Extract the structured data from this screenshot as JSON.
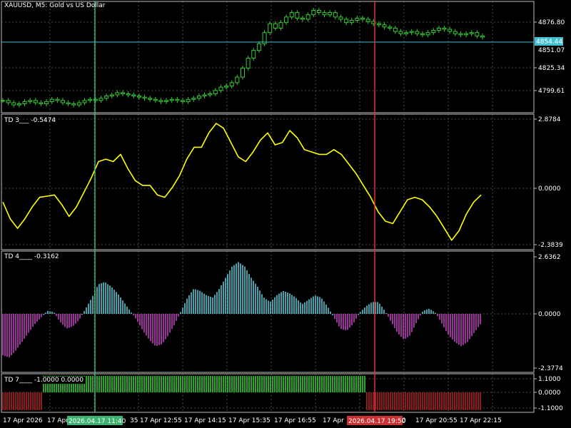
{
  "symbol_title": "XAUUSD, M5:  Gold vs US Dollar",
  "colors": {
    "background": "#000000",
    "grid": "#4a4a4a",
    "frame": "#c0c0c0",
    "candle": "#32cd32",
    "crosshair_green": "#3cb371",
    "crosshair_red": "#dc3232",
    "current_price_line": "#40c0d0",
    "td3_line": "#ffff00",
    "histogram_up": "#5bc8d8",
    "histogram_down": "#c040c0",
    "td7_up": "#32cd32",
    "td7_down": "#b22222"
  },
  "price_panel": {
    "axis_labels": [
      "4876.80",
      "4825.34",
      "4799.61"
    ],
    "current_price": "4854.44",
    "current_price_hidden_label": "4851.07"
  },
  "td3_panel": {
    "title": "TD 3___ -0.5474",
    "axis_labels": [
      "2.8784",
      "0.0000",
      "-2.3839"
    ]
  },
  "td4_panel": {
    "title": "TD 4____ -0.3162",
    "axis_labels": [
      "2.6362",
      "0.0000",
      "-2.3774"
    ]
  },
  "td7_panel": {
    "title": "TD 7____ -1.0000 0.0000",
    "axis_labels": [
      "1.1000",
      "0.0000",
      "-1.1000"
    ]
  },
  "time_axis": {
    "labels": [
      "17 Apr 2026",
      "17 Apr",
      "35",
      "17 Apr 12:55",
      "17 Apr 14:15",
      "17 Apr 15:35",
      "17 Apr 16:55",
      "17 Apr 1",
      "0",
      "17 Apr 20:55",
      "17 Apr 22:15"
    ],
    "cursor_green_label": "2026.04.17 11:40",
    "cursor_red_label": "2026.04.17 19:50"
  },
  "chart_data": {
    "type": "line",
    "title": "XAUUSD, M5:  Gold vs US Dollar",
    "price_series": {
      "name": "XAUUSD",
      "values": [
        4797,
        4795,
        4793,
        4794,
        4796,
        4797,
        4795,
        4794,
        4796,
        4798,
        4797,
        4795,
        4794,
        4793,
        4795,
        4797,
        4798,
        4797,
        4799,
        4801,
        4802,
        4804,
        4803,
        4802,
        4801,
        4800,
        4799,
        4798,
        4797,
        4796,
        4797,
        4798,
        4797,
        4796,
        4798,
        4799,
        4801,
        4802,
        4803,
        4806,
        4809,
        4810,
        4813,
        4818,
        4826,
        4835,
        4842,
        4848,
        4858,
        4866,
        4862,
        4867,
        4872,
        4876,
        4871,
        4870,
        4874,
        4878,
        4876,
        4874,
        4876,
        4872,
        4870,
        4867,
        4869,
        4871,
        4870,
        4868,
        4866,
        4865,
        4863,
        4862,
        4859,
        4857,
        4858,
        4859,
        4857,
        4856,
        4858,
        4860,
        4862,
        4861,
        4859,
        4857,
        4856,
        4857,
        4858,
        4855,
        4854
      ]
    },
    "td3_series": {
      "values": [
        -0.6,
        -1.3,
        -1.7,
        -1.3,
        -0.8,
        -0.4,
        -0.35,
        -0.3,
        -0.7,
        -1.2,
        -0.8,
        -0.2,
        0.4,
        1.1,
        1.2,
        1.1,
        1.4,
        0.8,
        0.3,
        0.1,
        0.1,
        -0.3,
        -0.4,
        0.0,
        0.5,
        1.2,
        1.7,
        1.7,
        2.3,
        2.7,
        2.5,
        1.9,
        1.3,
        1.1,
        1.5,
        2.0,
        2.3,
        1.8,
        1.9,
        2.4,
        2.1,
        1.6,
        1.5,
        1.4,
        1.4,
        1.6,
        1.4,
        1.0,
        0.6,
        0.1,
        -0.4,
        -1.0,
        -1.4,
        -1.5,
        -1.0,
        -0.5,
        -0.4,
        -0.5,
        -0.8,
        -1.2,
        -1.7,
        -2.2,
        -1.8,
        -1.1,
        -0.6,
        -0.3
      ]
    },
    "td4_series": {
      "values": [
        -1.8,
        -1.9,
        -1.6,
        -1.2,
        -0.8,
        -0.4,
        -0.1,
        0.2,
        0.15,
        -0.3,
        -0.6,
        -0.5,
        -0.2,
        0.3,
        0.8,
        1.4,
        1.5,
        1.3,
        1.0,
        0.6,
        0.2,
        -0.2,
        -0.7,
        -1.1,
        -1.4,
        -1.3,
        -0.9,
        -0.4,
        0.2,
        0.8,
        1.2,
        1.1,
        0.9,
        0.8,
        1.2,
        1.7,
        2.2,
        2.4,
        2.2,
        1.7,
        1.3,
        0.8,
        0.6,
        0.9,
        1.1,
        1.0,
        0.8,
        0.5,
        0.7,
        0.9,
        0.8,
        0.4,
        -0.1,
        -0.6,
        -0.7,
        -0.4,
        0.1,
        0.4,
        0.6,
        0.6,
        0.2,
        -0.3,
        -0.8,
        -1.1,
        -0.9,
        -0.3,
        0.2,
        0.3,
        0.1,
        -0.4,
        -0.9,
        -1.2,
        -1.4,
        -1.2,
        -0.8,
        -0.4
      ],
      "ylim": [
        -2.3774,
        2.6362
      ]
    },
    "td7_series": {
      "segments": [
        {
          "value": -1,
          "label": "down"
        },
        {
          "value": 1,
          "label": "up"
        },
        {
          "value": -1,
          "label": "down"
        }
      ]
    }
  }
}
